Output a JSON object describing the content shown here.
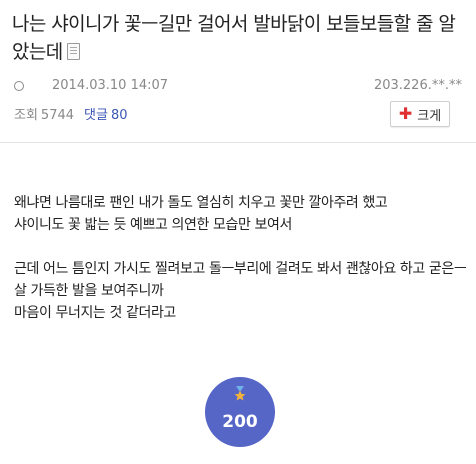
{
  "post": {
    "title": "나는 샤이니가 꽃ㅡ길만 걸어서 발바닭이 보들보들할 줄 알았는데",
    "date": "2014.03.10 14:07",
    "ip": "203.226.**.**",
    "views_label": "조회",
    "views": "5744",
    "comments_label": "댓글",
    "comments": "80",
    "zoom_label": "크게"
  },
  "content": {
    "paragraph1": [
      "왜냐면 나름대로 팬인 내가 돌도 열심히 치우고 꽃만 깔아주려 했고",
      "샤이니도 꽃 밟는 듯 예쁘고 의연한 모습만 보여서"
    ],
    "paragraph2": [
      "근데 어느 틈인지 가시도 찔려보고 돌ㅡ부리에 걸려도 봐서 괜찮아요 하고 굳은ㅡ살 가득한 발을 보여주니까",
      "마음이 무너지는 것 같더라고"
    ]
  },
  "vote": {
    "count": "200",
    "icon": "medal-star-icon"
  },
  "colors": {
    "accent": "#3b57b5",
    "vote_bg": "#5566c7",
    "zoom_plus": "#e03030"
  }
}
